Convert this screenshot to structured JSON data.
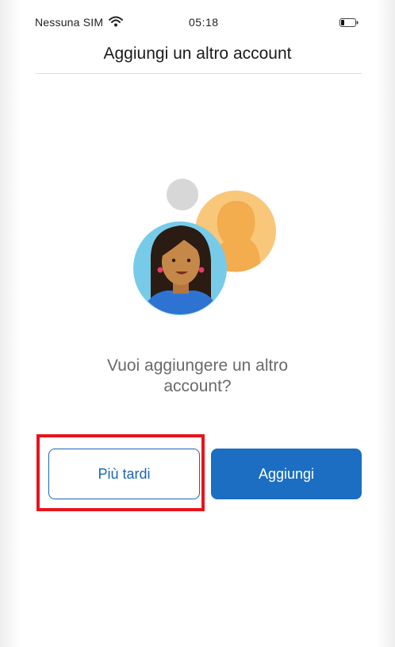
{
  "status_bar": {
    "carrier": "Nessuna SIM",
    "time": "05:18",
    "wifi_icon": "wifi-icon",
    "battery_icon": "battery-icon"
  },
  "header": {
    "title": "Aggiungi un altro account"
  },
  "main": {
    "illustration_icon": "add-account-illustration",
    "question": "Vuoi aggiungere un altro account?"
  },
  "actions": {
    "later_label": "Più tardi",
    "add_label": "Aggiungi"
  },
  "colors": {
    "primary": "#1b6ec2",
    "highlight": "#e8141c"
  }
}
